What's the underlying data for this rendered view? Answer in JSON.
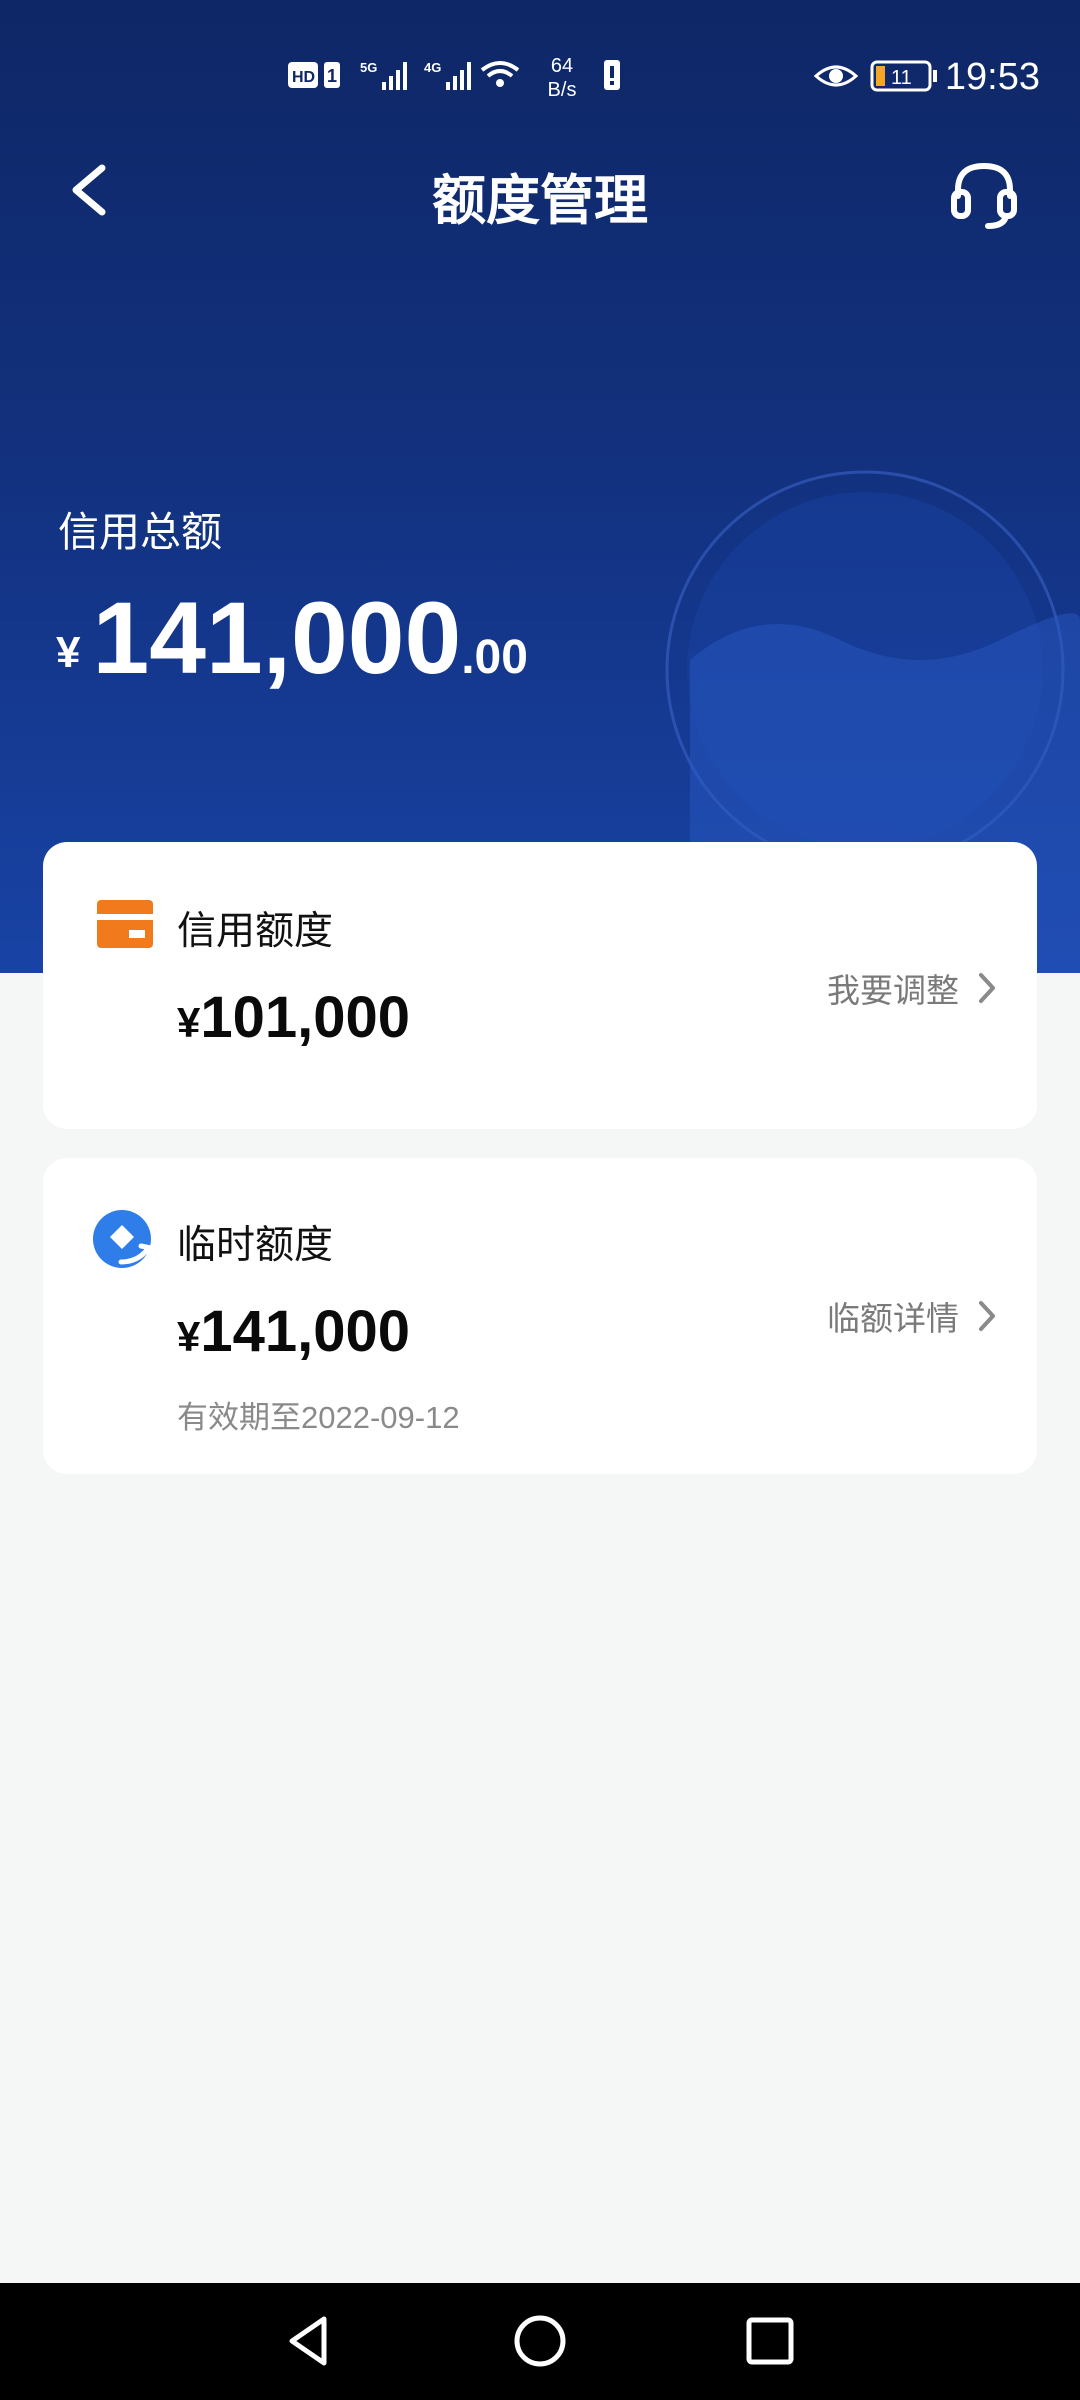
{
  "status_bar": {
    "time": "19:53",
    "net_speed_value": "64",
    "net_speed_unit": "B/s",
    "battery_level": "11"
  },
  "header": {
    "title": "额度管理",
    "back_icon": "chevron-left-icon",
    "service_icon": "headset-icon"
  },
  "summary": {
    "label": "信用总额",
    "currency": "¥",
    "amount_int": "141,000",
    "amount_dec": ".00"
  },
  "credit_card": {
    "title": "信用额度",
    "currency": "¥",
    "amount": "101,000",
    "action": "我要调整",
    "icon": "card-icon",
    "icon_color": "#f07a1c"
  },
  "temp_card": {
    "title": "临时额度",
    "currency": "¥",
    "amount": "141,000",
    "action": "临额详情",
    "validity": "有效期至2022-09-12",
    "icon": "temporary-limit-icon",
    "icon_color": "#2f7de8"
  },
  "colors": {
    "hero_top": "#0e2766",
    "hero_bottom": "#1843a5",
    "page_bg": "#f5f6f6"
  }
}
